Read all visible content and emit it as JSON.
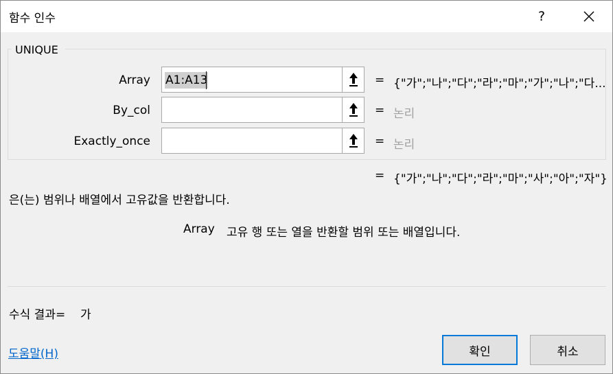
{
  "window": {
    "title": "함수 인수",
    "help_label": "?",
    "close_icon": "close-icon"
  },
  "function": {
    "name": "UNIQUE"
  },
  "arguments": [
    {
      "label": "Array",
      "value": "A1:A13",
      "evaluated": "{\"가\";\"나\";\"다\";\"라\";\"마\";\"가\";\"나\";\"다...",
      "muted": false
    },
    {
      "label": "By_col",
      "value": "",
      "evaluated": "논리",
      "muted": true
    },
    {
      "label": "Exactly_once",
      "value": "",
      "evaluated": "논리",
      "muted": true
    }
  ],
  "equals": "=",
  "result": {
    "value": "{\"가\";\"나\";\"다\";\"라\";\"마\";\"사\";\"아\";\"자\"}"
  },
  "description": {
    "function_text": "은(는) 범위나 배열에서 고유값을 반환합니다.",
    "arg_name": "Array",
    "arg_text": "고유 행 또는 열을 반환할 범위 또는 배열입니다."
  },
  "formula_result": {
    "label": "수식 결과=",
    "value": "가"
  },
  "footer": {
    "help_link": "도움말(H)",
    "ok_label": "확인",
    "cancel_label": "취소"
  },
  "colors": {
    "dialog_bg": "#f0f0f0",
    "titlebar_bg": "#ffffff",
    "link": "#0066cc",
    "default_button_border": "#0078d7",
    "muted_text": "#a0a0a0"
  }
}
